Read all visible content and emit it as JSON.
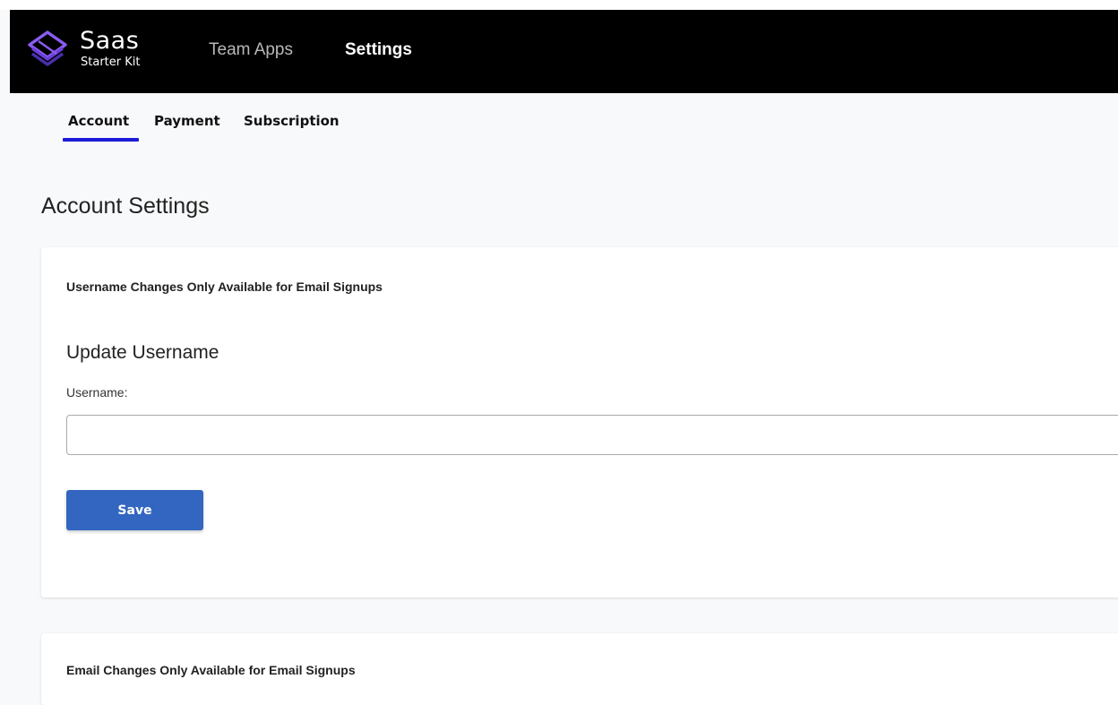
{
  "navbar": {
    "brand": {
      "title": "Saas",
      "subtitle": "Starter Kit",
      "logo_icon": "layered-diamond-logo-icon"
    },
    "links": [
      {
        "label": "Team Apps",
        "active": false
      },
      {
        "label": "Settings",
        "active": true
      }
    ]
  },
  "tabs": [
    {
      "label": "Account",
      "active": true
    },
    {
      "label": "Payment",
      "active": false
    },
    {
      "label": "Subscription",
      "active": false
    }
  ],
  "page": {
    "title": "Account Settings"
  },
  "username_card": {
    "note": "Username Changes Only Available for Email Signups",
    "section_title": "Update Username",
    "field_label": "Username:",
    "field_value": "",
    "field_placeholder": "",
    "save_label": "Save"
  },
  "email_card": {
    "note": "Email Changes Only Available for Email Signups"
  },
  "colors": {
    "navbar_bg": "#000000",
    "page_bg": "#f8f9fb",
    "accent": "#1b1bd8",
    "button_bg": "#3366c0",
    "logo_primary": "#7b4ee0"
  }
}
